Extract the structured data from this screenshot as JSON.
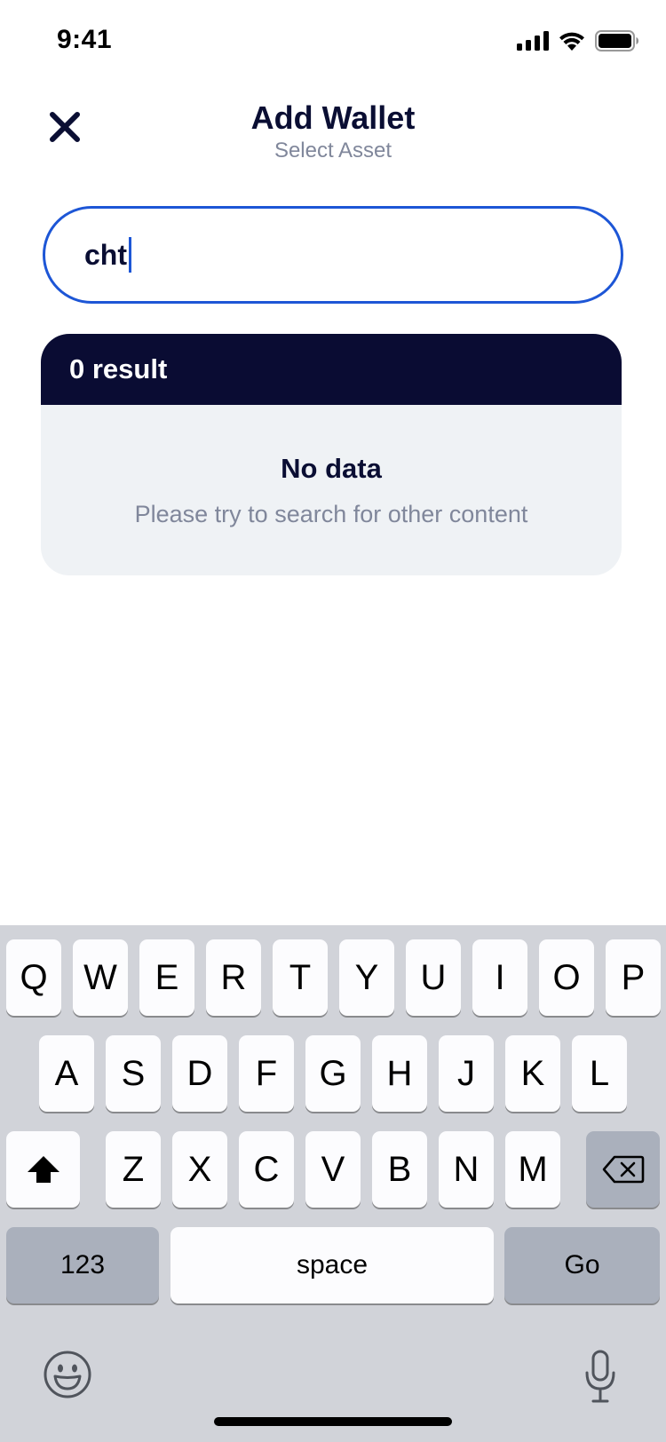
{
  "status_bar": {
    "time": "9:41"
  },
  "header": {
    "title": "Add Wallet",
    "subtitle": "Select Asset"
  },
  "search": {
    "value": "cht"
  },
  "results": {
    "count_label": "0 result",
    "empty_title": "No data",
    "empty_subtitle": "Please try to search for other content"
  },
  "keyboard": {
    "row1": [
      "Q",
      "W",
      "E",
      "R",
      "T",
      "Y",
      "U",
      "I",
      "O",
      "P"
    ],
    "row2": [
      "A",
      "S",
      "D",
      "F",
      "G",
      "H",
      "J",
      "K",
      "L"
    ],
    "row3": [
      "Z",
      "X",
      "C",
      "V",
      "B",
      "N",
      "M"
    ],
    "numbers_label": "123",
    "space_label": "space",
    "go_label": "Go"
  },
  "colors": {
    "accent": "#1d56d6",
    "navy": "#0a0c33",
    "muted": "#80879b",
    "card_bg": "#eff2f5",
    "keyboard_bg": "#d1d3d9"
  }
}
